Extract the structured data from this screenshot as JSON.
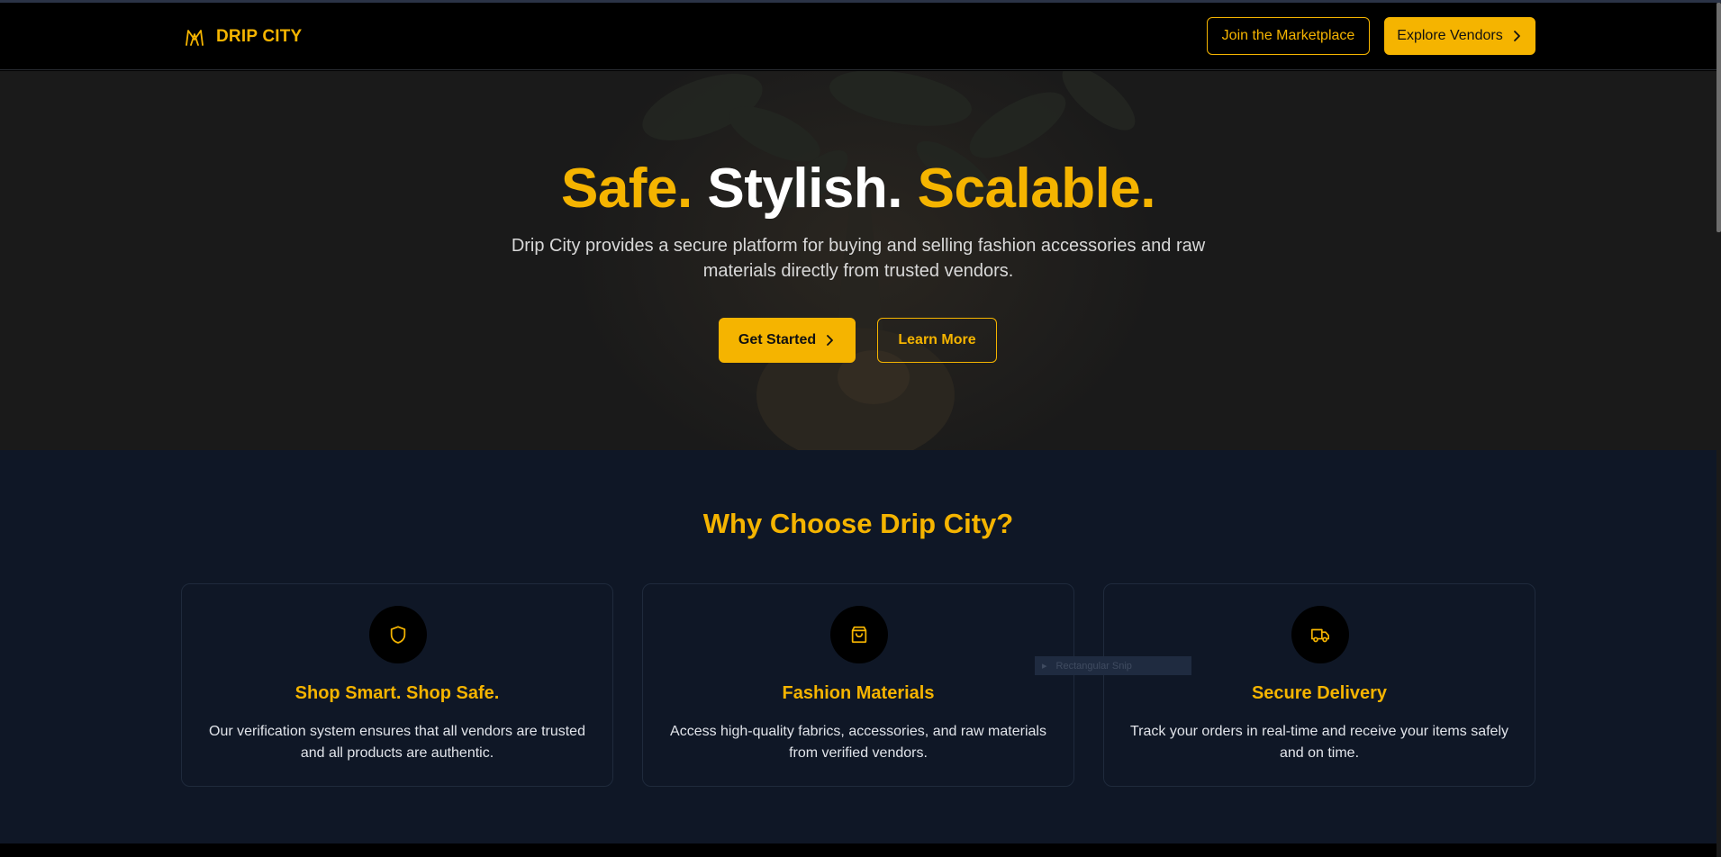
{
  "brand": {
    "name": "DRIP CITY",
    "logo_icon": "crown-m-logo-icon"
  },
  "header": {
    "join_label": "Join the Marketplace",
    "explore_label": "Explore Vendors"
  },
  "hero": {
    "title_part1": "Safe.",
    "title_part2": "Stylish.",
    "title_part3": "Scalable.",
    "subtitle": "Drip City provides a secure platform for buying and selling fashion accessories and raw materials directly from trusted vendors.",
    "primary_cta": "Get Started",
    "secondary_cta": "Learn More"
  },
  "features": {
    "heading": "Why Choose Drip City?",
    "cards": [
      {
        "icon": "shield-icon",
        "title": "Shop Smart. Shop Safe.",
        "text": "Our verification system ensures that all vendors are trusted and all products are authentic."
      },
      {
        "icon": "shopping-bag-icon",
        "title": "Fashion Materials",
        "text": "Access high-quality fabrics, accessories, and raw materials from verified vendors."
      },
      {
        "icon": "truck-icon",
        "title": "Secure Delivery",
        "text": "Track your orders in real-time and receive your items safely and on time."
      }
    ]
  },
  "overlay": {
    "snip_label": "Rectangular Snip"
  },
  "colors": {
    "accent": "#f5b400",
    "header_bg": "#000000",
    "hero_bg": "#1a1a1a",
    "features_bg": "#0f1726"
  }
}
